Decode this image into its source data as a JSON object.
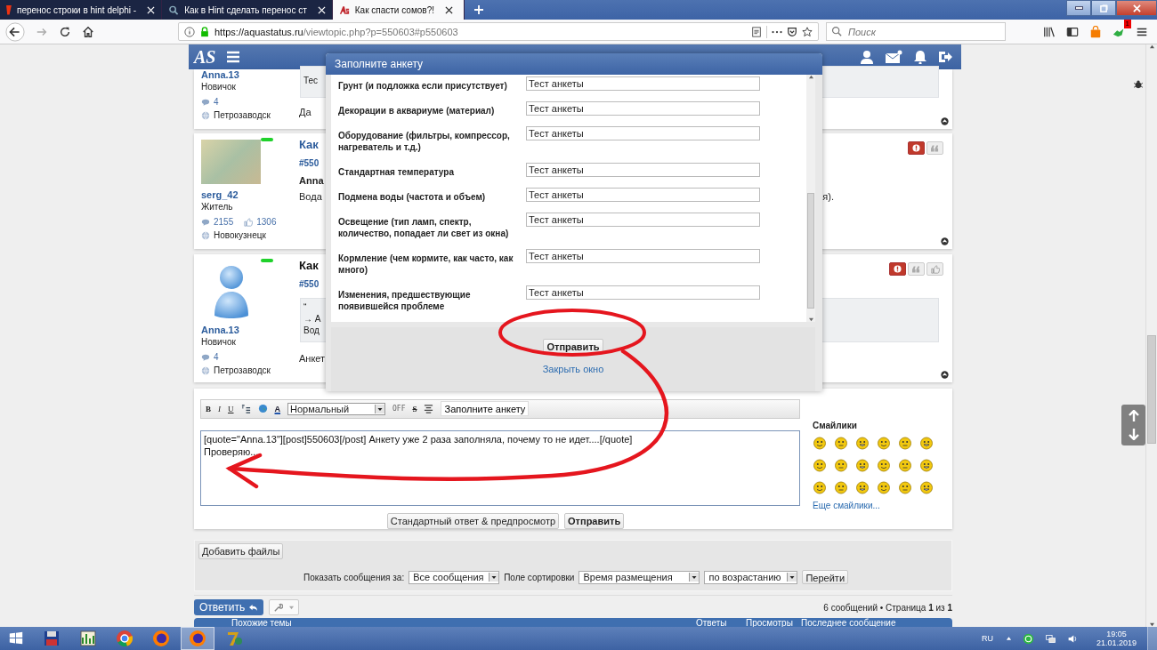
{
  "browser": {
    "tabs": [
      {
        "title": "перенос строки в hint delphi -",
        "kind": "yandex",
        "selected": false
      },
      {
        "title": "Как в Hint сделать перенос ст",
        "kind": "search",
        "selected": false
      },
      {
        "title": "Как спасти сомов?!",
        "kind": "site",
        "selected": true
      }
    ],
    "url_host": "https://aquastatus.ru",
    "url_path": "/viewtopic.php?p=550603#p550603",
    "search": {
      "placeholder": "Поиск"
    },
    "extension_badge": "1"
  },
  "site_header": {
    "logo": "AS"
  },
  "posts": [
    {
      "author": "Anna.13",
      "rank": "Новичок",
      "messages": "4",
      "location": "Петрозаводск",
      "online": false,
      "content": [
        {
          "kind": "quote",
          "lines": [
            "Тес"
          ]
        },
        {
          "kind": "text",
          "text": "Да"
        }
      ]
    },
    {
      "author": "serg_42",
      "rank": "Житель",
      "messages": "2155",
      "likes": "1306",
      "location": "Новокузнецк",
      "online": true,
      "avatar": {
        "kind": "photo"
      },
      "actions": [
        {
          "kind": "report"
        },
        {
          "kind": "quote"
        }
      ],
      "content": [
        {
          "kind": "title",
          "text": "Как"
        },
        {
          "kind": "postnum",
          "text": "#550"
        },
        {
          "kind": "strong",
          "text": "Anna"
        },
        {
          "kind": "text",
          "text": "Вода",
          "tail": "я)."
        }
      ]
    },
    {
      "author": "Anna.13",
      "rank": "Новичок",
      "messages": "4",
      "location": "Петрозаводск",
      "online": true,
      "avatar": {
        "kind": "default"
      },
      "actions": [
        {
          "kind": "report"
        },
        {
          "kind": "quote"
        },
        {
          "kind": "like"
        }
      ],
      "content": [
        {
          "kind": "title",
          "text": "Как"
        },
        {
          "kind": "postnum",
          "text": "#550"
        },
        {
          "kind": "quote",
          "lines": [
            "“",
            "→ А",
            "Вод"
          ]
        },
        {
          "kind": "text",
          "text": "Анкет"
        }
      ]
    }
  ],
  "editor": {
    "toolbar": [
      {
        "kind": "bold",
        "label": "B"
      },
      {
        "kind": "italic",
        "label": "I"
      },
      {
        "kind": "underline",
        "label": "U"
      },
      {
        "kind": "list"
      },
      {
        "kind": "link"
      },
      {
        "kind": "color",
        "label": "A"
      },
      {
        "kind": "select",
        "value": "Нормальный"
      },
      {
        "kind": "toggle",
        "label": "OFF"
      },
      {
        "kind": "strike",
        "label": "S"
      },
      {
        "kind": "align"
      },
      {
        "kind": "button",
        "label": "Заполните анкету"
      }
    ],
    "value": "[quote=\"Anna.13\"][post]550603[/post] Анкету уже 2 раза заполняла, почему то не идет....[/quote]\nПроверяю...",
    "smileys_title": "Смайлики",
    "more_smileys": "Еще смайлики...",
    "buttons": [
      "Стандартный ответ & предпросмотр",
      "Отправить"
    ]
  },
  "attachments": {
    "button": "Добавить файлы"
  },
  "display_options": {
    "show_label": "Показать сообщения за:",
    "show_value": "Все сообщения",
    "sort_label": "Поле сортировки",
    "sort_value": "Время размещения",
    "order_value": "по возрастанию",
    "go_button": "Перейти"
  },
  "actions": {
    "reply_button": "Ответить",
    "pagination": "6 сообщений • Страница **1** из **1**"
  },
  "related": {
    "columns": [
      "Похожие темы",
      "Ответы",
      "Просмотры",
      "Последнее сообщение"
    ]
  },
  "modal": {
    "title": "Заполните анкету",
    "fields": [
      {
        "label": "Грунт (и подложка если присутствует)",
        "value": "Тест анкеты"
      },
      {
        "label": "Декорации в аквариуме (материал)",
        "value": "Тест анкеты"
      },
      {
        "label": "Оборудование (фильтры, компрессор, нагреватель и т.д.)",
        "value": "Тест анкеты"
      },
      {
        "label": "Стандартная температура",
        "value": "Тест анкеты"
      },
      {
        "label": "Подмена воды (частота и объем)",
        "value": "Тест анкеты"
      },
      {
        "label": "Освещение (тип ламп, спектр, количество, попадает ли свет из окна)",
        "value": "Тест анкеты"
      },
      {
        "label": "Кормление (чем кормите, как часто, как много)",
        "value": "Тест анкеты"
      },
      {
        "label": "Изменения, предшествующие появившейся проблеме",
        "value": "Тест анкеты"
      }
    ],
    "submit": "Отправить",
    "close_link": "Закрыть окно"
  },
  "taskbar": {
    "apps": [
      {
        "kind": "media",
        "selected": false
      },
      {
        "kind": "chart",
        "selected": false
      },
      {
        "kind": "chrome",
        "selected": false
      },
      {
        "kind": "firefox",
        "selected": false
      },
      {
        "kind": "firefox",
        "selected": true
      },
      {
        "kind": "archive",
        "selected": false
      }
    ],
    "language": "RU",
    "time": "19:05",
    "date": "21.01.2019"
  }
}
